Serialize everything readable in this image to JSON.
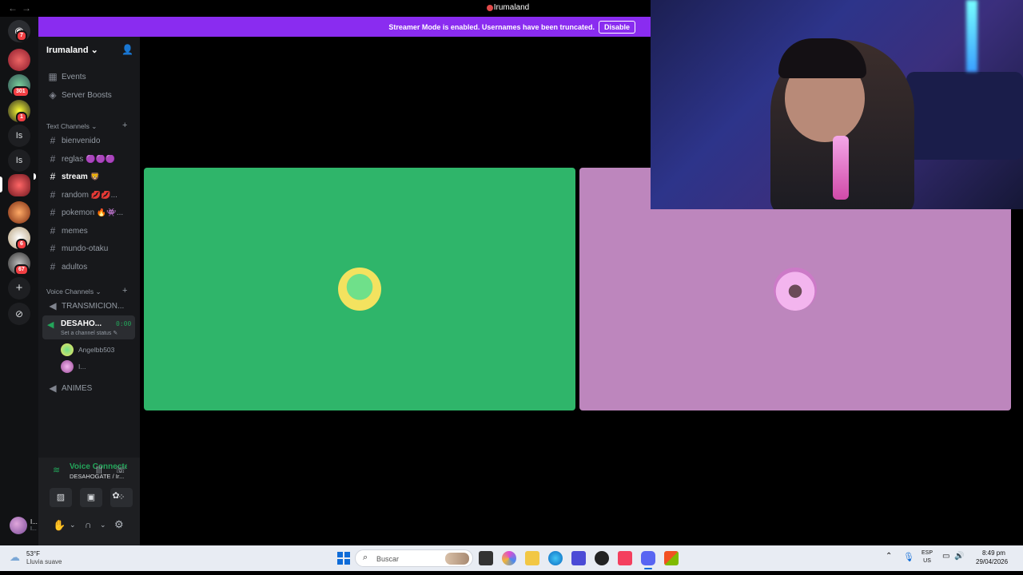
{
  "window": {
    "title": "Irumaland"
  },
  "banner": {
    "text": "Streamer Mode is enabled. Usernames have been truncated.",
    "button": "Disable",
    "color": "#8a2cf0"
  },
  "server_list": {
    "badges": [
      "7",
      "301",
      "1",
      "6",
      "67"
    ],
    "text_servers": [
      "Is",
      "Is"
    ]
  },
  "sidebar": {
    "server_name": "Irumaland",
    "top_items": [
      {
        "label": "Events",
        "icon": "calendar-icon"
      },
      {
        "label": "Server Boosts",
        "icon": "boost-icon"
      }
    ],
    "text_category": "Text Channels",
    "text_channels": [
      {
        "label": "bienvenido"
      },
      {
        "label": "reglas 🟣🟣🟣"
      },
      {
        "label": "stream 🦁"
      },
      {
        "label": "random 💋💋..."
      },
      {
        "label": "pokemon 🔥👾..."
      },
      {
        "label": "memes"
      },
      {
        "label": "mundo-otaku"
      },
      {
        "label": "adultos"
      }
    ],
    "voice_category": "Voice Channels",
    "voice_channels": [
      {
        "label": "TRANSMICION..."
      },
      {
        "label": "DESAHO...",
        "timer": "0:00",
        "status": "Set a channel status ✎"
      },
      {
        "label": "ANIMES"
      }
    ],
    "voice_users": [
      "Angelbb503",
      "I..."
    ]
  },
  "voice_panel": {
    "title": "Voice Connecte",
    "subtitle": "DESAHOGATE / Ir...",
    "username": "I...",
    "user_sub": "I..."
  },
  "stage": {
    "green_color": "#2fb56a",
    "pink_color": "#bd86bd"
  },
  "taskbar": {
    "weather_temp": "53°F",
    "weather_desc": "Lluvia suave",
    "search_placeholder": "Buscar",
    "lang_top": "ESP",
    "lang_bottom": "US",
    "time": "8:49 pm",
    "date": "29/04/2026"
  }
}
